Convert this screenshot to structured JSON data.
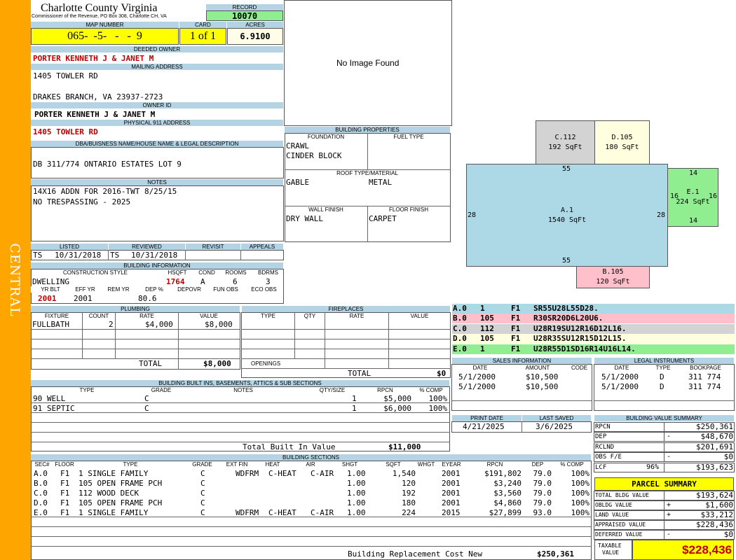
{
  "side_label": "CENTRAL",
  "header": {
    "county": "Charlotte County Virginia",
    "commissioner": "Commissioner of the Revenue, PO Box 308, Charlotte CH, VA",
    "record_label": "RECORD",
    "record": "10070"
  },
  "map": {
    "map_label": "MAP NUMBER",
    "map_number": "065-  -5-   -   -  9",
    "card_label": "CARD",
    "card": "1 of 1",
    "acres_label": "ACRES",
    "acres": "6.9100"
  },
  "owner": {
    "deeded_label": "DEEDED OWNER",
    "deeded": "PORTER KENNETH J & JANET M",
    "mailing_label": "MAILING ADDRESS",
    "mail1": "1405 TOWLER RD",
    "mail2": "DRAKES BRANCH, VA 23937-2723",
    "ownerid_label": "OWNER ID",
    "ownerid": "PORTER KENNETH J & JANET M",
    "phys_label": "PHYSICAL 911 ADDRESS",
    "phys": "1405 TOWLER RD"
  },
  "legal": {
    "label": "DBA/BUISNESS NAME/HOUSE NAME & LEGAL DESCRIPTION",
    "text": "DB 311/774 ONTARIO ESTATES LOT 9"
  },
  "notes": {
    "label": "NOTES",
    "line1": "14X16 ADDN FOR 2016-TWT 8/25/15",
    "line2": "NO TRESPASSING - 2025"
  },
  "image_text": "No Image Found",
  "listed": {
    "l1": "LISTED",
    "l2": "REVIEWED",
    "l3": "REVISIT",
    "l4": "APPEALS",
    "listed_by": "TS",
    "listed_date": "10/31/2018",
    "rev_by": "TS",
    "rev_date": "10/31/2018"
  },
  "bldg_info": {
    "label": "BUILDING INFORMATION",
    "h_cs": "CONSTRUCTION STYLE",
    "h_hs": "HSQFT",
    "h_cond": "COND",
    "h_rooms": "ROOMS",
    "h_bd": "BDRMS",
    "cs": "DWELLING",
    "hs": "1764",
    "cond": "A",
    "rooms": "6",
    "bd": "3",
    "h_yb": "YR BLT",
    "h_ey": "EFF YR",
    "h_ry": "REM YR",
    "h_dp": "DEP %",
    "h_dov": "DEPOVR",
    "h_fo": "FUN OBS",
    "h_eo": "ECO OBS",
    "yb": "2001",
    "ey": "2001",
    "dp": "80.6"
  },
  "bldg_props": {
    "label": "BUILDING PROPERTIES",
    "h_found": "FOUNDATION",
    "h_fuel": "FUEL TYPE",
    "found1": "CRAWL",
    "found2": "CINDER BLOCK",
    "h_roof": "ROOF TYPE/MATERIAL",
    "roof": "GABLE",
    "roof_mat": "METAL",
    "h_wall": "WALL FINISH",
    "h_floor": "FLOOR FINISH",
    "wall": "DRY WALL",
    "floor": "CARPET"
  },
  "plumbing": {
    "label": "PLUMBING",
    "h_fix": "FIXTURE",
    "h_cnt": "COUNT",
    "h_rate": "RATE",
    "h_val": "VALUE",
    "fix": "FULLBATH",
    "cnt": "2",
    "rate": "$4,000",
    "val": "$8,000",
    "total_label": "TOTAL",
    "total": "$8,000"
  },
  "fireplaces": {
    "label": "FIREPLACES",
    "h_type": "TYPE",
    "h_qty": "QTY",
    "h_rate": "RATE",
    "h_val": "VALUE",
    "openings": "OPENINGS",
    "total_label": "TOTAL",
    "total": "$0"
  },
  "builtins": {
    "label": "BUILDING BUILT INS, BASEMENTS, ATTICS & SUB SECTIONS",
    "h_type": "TYPE",
    "h_grade": "GRADE",
    "h_notes": "NOTES",
    "h_qty": "QTY/SIZE",
    "h_rpcn": "RPCN",
    "h_comp": "% COMP",
    "rows": [
      {
        "type": "90 WELL",
        "grade": "C",
        "qty": "1",
        "rpcn": "$5,000",
        "comp": "100%"
      },
      {
        "type": "91 SEPTIC",
        "grade": "C",
        "qty": "1",
        "rpcn": "$6,000",
        "comp": "100%"
      }
    ],
    "total_label": "Total Built In Value",
    "total": "$11,000"
  },
  "sections": {
    "label": "BUILDING SECTIONS",
    "h": [
      "SEC#",
      "FLOOR",
      "TYPE",
      "GRADE",
      "EXT FIN",
      "HEAT",
      "AIR",
      "SHGT",
      "SQFT",
      "WHGT",
      "EYEAR",
      "RPCN",
      "DEP",
      "% COMP"
    ],
    "rows": [
      [
        "A.0",
        "F1",
        "1 SINGLE FAMILY",
        "C",
        "WDFRM",
        "C-HEAT",
        "C-AIR",
        "1.00",
        "1,540",
        "",
        "2001",
        "$191,802",
        "79.0",
        "100%"
      ],
      [
        "B.0",
        "F1",
        "105 OPEN FRAME PCH",
        "C",
        "",
        "",
        "",
        "1.00",
        "120",
        "",
        "2001",
        "$3,240",
        "79.0",
        "100%"
      ],
      [
        "C.0",
        "F1",
        "112 WOOD DECK",
        "C",
        "",
        "",
        "",
        "1.00",
        "192",
        "",
        "2001",
        "$3,560",
        "79.0",
        "100%"
      ],
      [
        "D.0",
        "F1",
        "105 OPEN FRAME PCH",
        "C",
        "",
        "",
        "",
        "1.00",
        "180",
        "",
        "2001",
        "$4,860",
        "79.0",
        "100%"
      ],
      [
        "E.0",
        "F1",
        "1 SINGLE FAMILY",
        "C",
        "WDFRM",
        "C-HEAT",
        "C-AIR",
        "1.00",
        "224",
        "",
        "2015",
        "$27,899",
        "93.0",
        "100%"
      ]
    ],
    "brcn_label": "Building Replacement Cost New",
    "brcn": "$250,361"
  },
  "sketch": {
    "a_name": "A.1",
    "a_area": "1540 SqFt",
    "a_top": "55",
    "a_bottom": "55",
    "a_left": "28",
    "a_right": "28",
    "b_name": "B.105",
    "b_area": "120 SqFt",
    "c_name": "C.112",
    "c_area": "192 SqFt",
    "d_name": "D.105",
    "d_area": "180 SqFt",
    "e_name": "E.1",
    "e_area": "224 SqFt",
    "e_top": "14",
    "e_bottom": "14",
    "e_left": "16",
    "e_right": "16"
  },
  "vectors": [
    {
      "sec": "A.0",
      "n": "1",
      "f": "F1",
      "v": "SR55U28L55D28.",
      "color": "#add8e6"
    },
    {
      "sec": "B.0",
      "n": "105",
      "f": "F1",
      "v": "R30SR20D6L20U6.",
      "color": "#ffc0cb"
    },
    {
      "sec": "C.0",
      "n": "112",
      "f": "F1",
      "v": "U28R19SU12R16D12L16.",
      "color": "#d3d3d3"
    },
    {
      "sec": "D.0",
      "n": "105",
      "f": "F1",
      "v": "U28R35SU12R15D12L15.",
      "color": "#ffffe0"
    },
    {
      "sec": "E.0",
      "n": "1",
      "f": "F1",
      "v": "U28R55D1SD16R14U16L14.",
      "color": "#90ee90"
    }
  ],
  "sales": {
    "label": "SALES INFORMATION",
    "h_date": "DATE",
    "h_amt": "AMOUNT",
    "h_code": "CODE",
    "rows": [
      {
        "date": "5/1/2000",
        "amt": "$10,500"
      },
      {
        "date": "5/1/2000",
        "amt": "$10,500"
      }
    ]
  },
  "legal_inst": {
    "label": "LEGAL INSTRUMENTS",
    "h_date": "DATE",
    "h_type": "TYPE",
    "h_bp": "BOOKPAGE",
    "rows": [
      {
        "date": "5/1/2000",
        "type": "D",
        "bp": "311 774"
      },
      {
        "date": "5/1/2000",
        "type": "D",
        "bp": "311 774"
      }
    ]
  },
  "print": {
    "h_pd": "PRINT DATE",
    "h_ls": "LAST SAVED",
    "pd": "4/21/2025",
    "ls": "3/6/2025"
  },
  "bvs": {
    "label": "BUILDING VALUE SUMMARY",
    "rows": [
      {
        "k": "RPCN",
        "s": "",
        "v": "$250,361"
      },
      {
        "k": "DEP",
        "s": "-",
        "v": "$48,670"
      },
      {
        "k": "RCLND",
        "s": "",
        "v": "$201,691"
      },
      {
        "k": "OBS F/E",
        "s": "-",
        "v": "$0"
      },
      {
        "k": "LCF",
        "p": "96%",
        "s": "",
        "v": "$193,623"
      }
    ]
  },
  "parcel": {
    "label": "PARCEL SUMMARY",
    "rows": [
      {
        "k": "TOTAL BLDG VALUE",
        "s": "",
        "v": "$193,624"
      },
      {
        "k": "OBLDG VALUE",
        "s": "+",
        "v": "$1,600"
      },
      {
        "k": "LAND VALUE",
        "s": "+",
        "v": "$33,212"
      },
      {
        "k": "APPRAISED VALUE",
        "s": "",
        "v": "$228,436"
      },
      {
        "k": "DEFERRED VALUE",
        "s": "-",
        "v": "$0"
      }
    ],
    "taxable_label1": "TAXABLE",
    "taxable_label2": "VALUE",
    "taxable": "$228,436"
  }
}
